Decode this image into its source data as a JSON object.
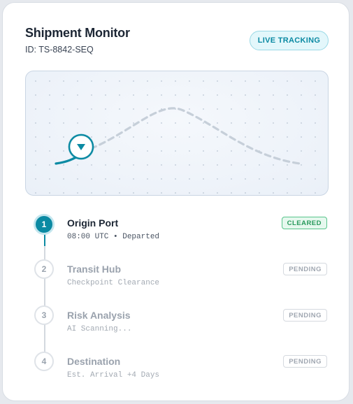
{
  "header": {
    "title": "Shipment Monitor",
    "shipment_id": "ID: TS-8842-SEQ",
    "live_badge": "LIVE TRACKING"
  },
  "map": {
    "route_progress": 0.12,
    "marker_icon": "navigation-arrow-icon",
    "route_color": "#0b8aa3",
    "pending_route_color": "#c6cfd9"
  },
  "steps": [
    {
      "number": "1",
      "name": "Origin Port",
      "detail": "08:00 UTC • Departed",
      "status": "CLEARED",
      "state": "done"
    },
    {
      "number": "2",
      "name": "Transit Hub",
      "detail": "Checkpoint Clearance",
      "status": "PENDING",
      "state": "pending"
    },
    {
      "number": "3",
      "name": "Risk Analysis",
      "detail": "AI Scanning...",
      "status": "PENDING",
      "state": "pending"
    },
    {
      "number": "4",
      "name": "Destination",
      "detail": "Est. Arrival +4 Days",
      "status": "PENDING",
      "state": "pending"
    }
  ],
  "colors": {
    "accent": "#0b8aa3",
    "cleared": "#27995b",
    "pending": "#a0a7b1"
  }
}
